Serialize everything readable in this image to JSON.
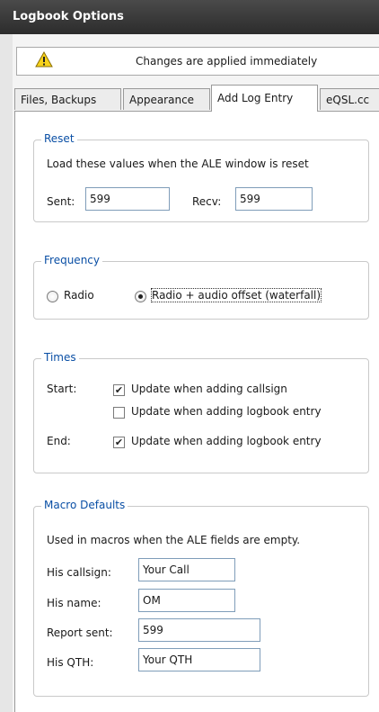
{
  "window": {
    "title": "Logbook Options"
  },
  "notice": {
    "icon": "warning-icon",
    "text": "Changes are applied immediately"
  },
  "tabs": [
    {
      "label": "Files, Backups"
    },
    {
      "label": "Appearance"
    },
    {
      "label": "Add Log Entry",
      "active": true
    },
    {
      "label": "eQSL.cc"
    }
  ],
  "reset": {
    "legend": "Reset",
    "description": "Load these values when the ALE window is reset",
    "sent_label": "Sent:",
    "sent_value": "599",
    "recv_label": "Recv:",
    "recv_value": "599"
  },
  "frequency": {
    "legend": "Frequency",
    "options": [
      {
        "label": "Radio",
        "selected": false
      },
      {
        "label": "Radio + audio offset (waterfall)",
        "selected": true
      }
    ]
  },
  "times": {
    "legend": "Times",
    "start_label": "Start:",
    "start_options": [
      {
        "label": "Update when adding callsign",
        "checked": true
      },
      {
        "label": "Update when adding logbook entry",
        "checked": false
      }
    ],
    "end_label": "End:",
    "end_options": [
      {
        "label": "Update when adding logbook entry",
        "checked": true
      }
    ]
  },
  "macros": {
    "legend": "Macro Defaults",
    "description": "Used in macros when the ALE fields are empty.",
    "fields": [
      {
        "label": "His callsign:",
        "value": "Your Call"
      },
      {
        "label": "His name:",
        "value": "OM"
      },
      {
        "label": "Report sent:",
        "value": "599"
      },
      {
        "label": "His QTH:",
        "value": "Your QTH"
      }
    ]
  },
  "colors": {
    "titlebar": "#333333",
    "legend": "#0a4fa5",
    "border": "#c9c9c9"
  }
}
